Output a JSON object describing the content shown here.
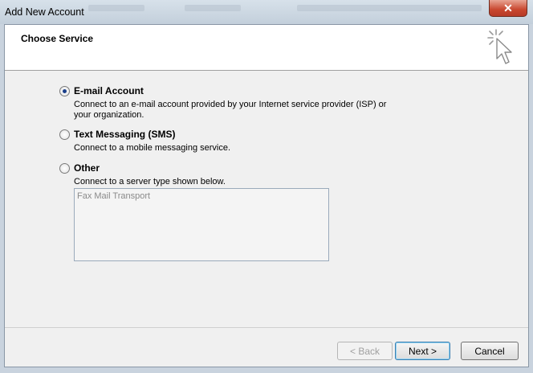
{
  "window": {
    "title": "Add New Account",
    "close_glyph": "✕"
  },
  "header": {
    "title": "Choose Service"
  },
  "options": [
    {
      "label": "E-mail Account",
      "description_line1": "Connect to an e-mail account provided by your Internet service provider (ISP) or",
      "description_line2": "your organization.",
      "selected": true
    },
    {
      "label": "Text Messaging (SMS)",
      "description_line1": "Connect to a mobile messaging service.",
      "selected": false
    },
    {
      "label": "Other",
      "description_line1": "Connect to a server type shown below.",
      "selected": false
    }
  ],
  "server_types": [
    "Fax Mail Transport"
  ],
  "buttons": {
    "back": "< Back",
    "next": "Next >",
    "cancel": "Cancel"
  }
}
